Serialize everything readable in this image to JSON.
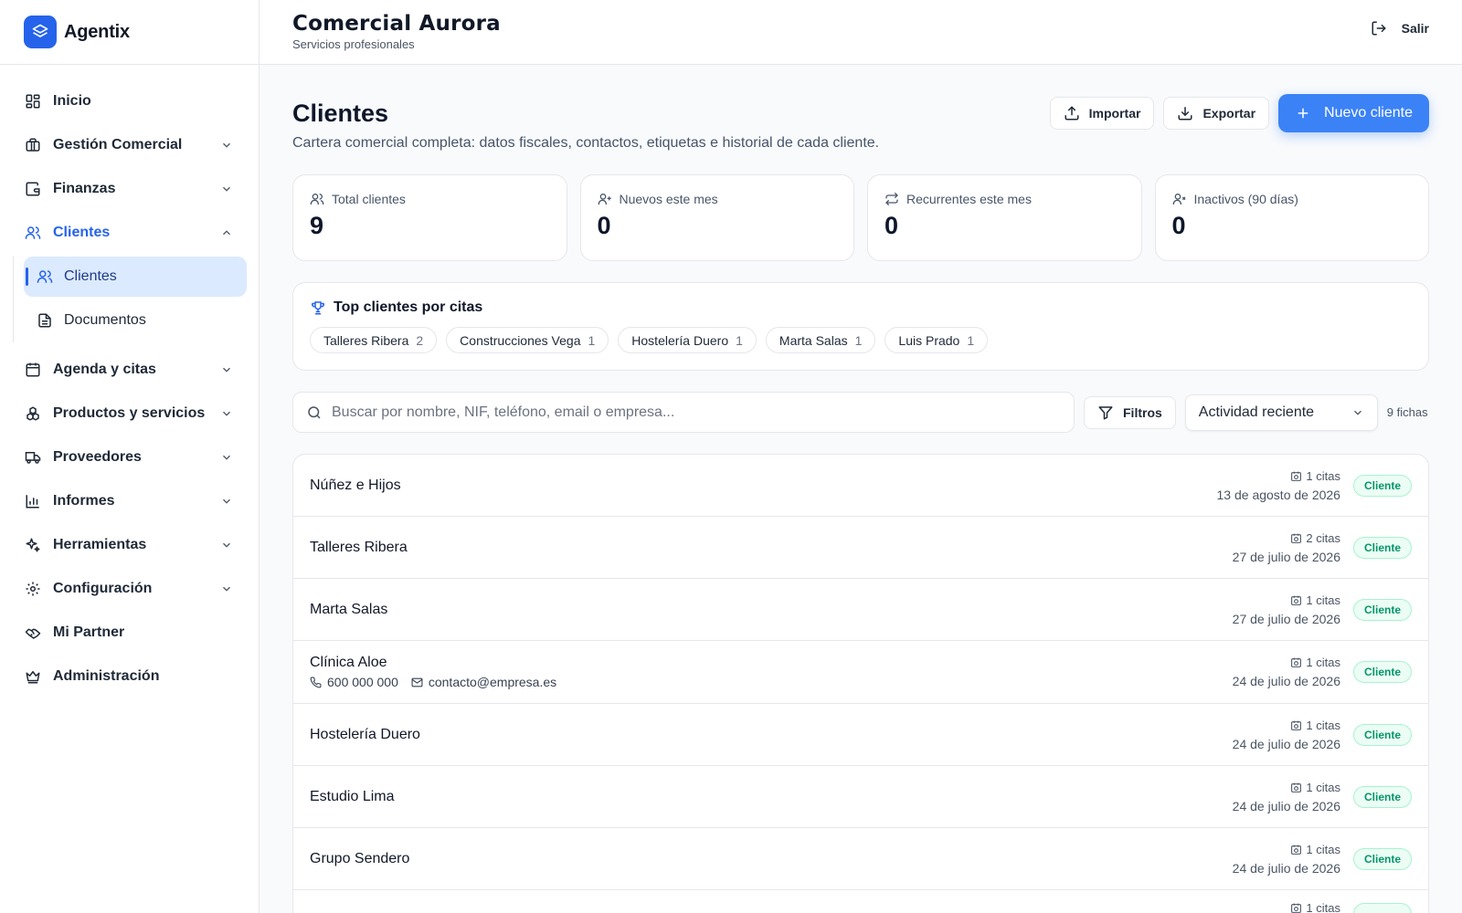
{
  "brand": {
    "name": "Agentix",
    "accent": "#2563eb"
  },
  "topbar": {
    "company": "Comercial Aurora",
    "subtitle": "Servicios profesionales",
    "logout_label": "Salir"
  },
  "sidebar": {
    "items": [
      {
        "label": "Inicio",
        "icon": "dashboard-icon"
      },
      {
        "label": "Gestión Comercial",
        "icon": "briefcase-icon"
      },
      {
        "label": "Finanzas",
        "icon": "wallet-icon"
      },
      {
        "label": "Clientes",
        "icon": "users-icon"
      },
      {
        "label": "Agenda y citas",
        "icon": "calendar-icon"
      },
      {
        "label": "Productos y servicios",
        "icon": "boxes-icon"
      },
      {
        "label": "Proveedores",
        "icon": "truck-icon"
      },
      {
        "label": "Informes",
        "icon": "bar-chart-icon"
      },
      {
        "label": "Herramientas",
        "icon": "sparkles-icon"
      },
      {
        "label": "Configuración",
        "icon": "gear-icon"
      },
      {
        "label": "Mi Partner",
        "icon": "handshake-icon"
      },
      {
        "label": "Administración",
        "icon": "crown-icon"
      }
    ],
    "sub_clientes": [
      {
        "label": "Clientes",
        "icon": "users-icon"
      },
      {
        "label": "Documentos",
        "icon": "document-icon"
      }
    ]
  },
  "page": {
    "title": "Clientes",
    "description": "Cartera comercial completa: datos fiscales, contactos, etiquetas e historial de cada cliente.",
    "import_label": "Importar",
    "export_label": "Exportar",
    "new_label": "Nuevo cliente"
  },
  "stats": [
    {
      "label": "Total clientes",
      "value": "9"
    },
    {
      "label": "Nuevos este mes",
      "value": "0"
    },
    {
      "label": "Recurrentes este mes",
      "value": "0"
    },
    {
      "label": "Inactivos (90 días)",
      "value": "0"
    }
  ],
  "top_clients": {
    "title": "Top clientes por citas",
    "items": [
      {
        "name": "Talleres Ribera",
        "count": "2"
      },
      {
        "name": "Construcciones Vega",
        "count": "1"
      },
      {
        "name": "Hostelería Duero",
        "count": "1"
      },
      {
        "name": "Marta Salas",
        "count": "1"
      },
      {
        "name": "Luis Prado",
        "count": "1"
      }
    ]
  },
  "search": {
    "placeholder": "Buscar por nombre, NIF, teléfono, email o empresa...",
    "value": ""
  },
  "filters_label": "Filtros",
  "sort": {
    "selected": "Actividad reciente"
  },
  "records_count": "9 fichas",
  "clients": [
    {
      "name": "Núñez e Hijos",
      "citas": "1 citas",
      "date": "13 de agosto de 2026",
      "status": "Cliente"
    },
    {
      "name": "Talleres Ribera",
      "citas": "2 citas",
      "date": "27 de julio de 2026",
      "status": "Cliente"
    },
    {
      "name": "Marta Salas",
      "citas": "1 citas",
      "date": "27 de julio de 2026",
      "status": "Cliente"
    },
    {
      "name": "Clínica Aloe",
      "phone": "600 000 000",
      "email": "contacto@empresa.es",
      "citas": "1 citas",
      "date": "24 de julio de 2026",
      "status": "Cliente"
    },
    {
      "name": "Hostelería Duero",
      "citas": "1 citas",
      "date": "24 de julio de 2026",
      "status": "Cliente"
    },
    {
      "name": "Estudio Lima",
      "citas": "1 citas",
      "date": "24 de julio de 2026",
      "status": "Cliente"
    },
    {
      "name": "Grupo Sendero",
      "citas": "1 citas",
      "date": "24 de julio de 2026",
      "status": "Cliente"
    },
    {
      "name": "",
      "citas": "1 citas",
      "date": "",
      "status": ""
    }
  ]
}
